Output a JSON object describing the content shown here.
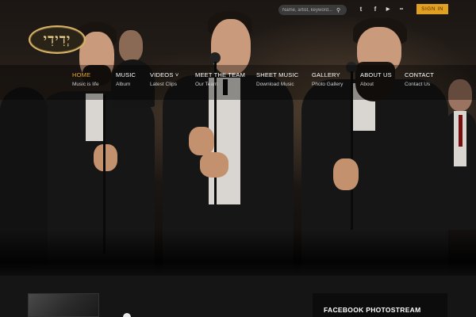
{
  "topbar": {
    "search_placeholder": "Name, artist, keyword...",
    "search_icon": "search-icon",
    "social": [
      {
        "name": "twitter-icon",
        "glyph": "t"
      },
      {
        "name": "facebook-icon",
        "glyph": "f"
      },
      {
        "name": "youtube-icon",
        "glyph": "▶"
      },
      {
        "name": "flickr-icon",
        "glyph": "••"
      }
    ],
    "signin_label": "SIGN IN"
  },
  "logo": {
    "text": "יְדִידִי",
    "name": "logo"
  },
  "nav": [
    {
      "label": "HOME",
      "sub": "Music is life",
      "active": true
    },
    {
      "label": "MUSIC",
      "sub": "Album",
      "active": false
    },
    {
      "label": "VIDEOS ˅",
      "sub": "Latest Clips",
      "active": false
    },
    {
      "label": "MEET THE TEAM",
      "sub": "Our Team",
      "active": false
    },
    {
      "label": "SHEET MUSIC",
      "sub": "Download Music",
      "active": false
    },
    {
      "label": "GALLERY",
      "sub": "Photo Gallery",
      "active": false
    },
    {
      "label": "ABOUT US",
      "sub": "About",
      "active": false
    },
    {
      "label": "CONTACT",
      "sub": "Contact Us",
      "active": false
    }
  ],
  "sidebar": {
    "facebook_title": "FACEBOOK PHOTOSTREAM"
  },
  "colors": {
    "accent": "#e2a020",
    "nav_active": "#e5a52b",
    "background": "#111111"
  }
}
